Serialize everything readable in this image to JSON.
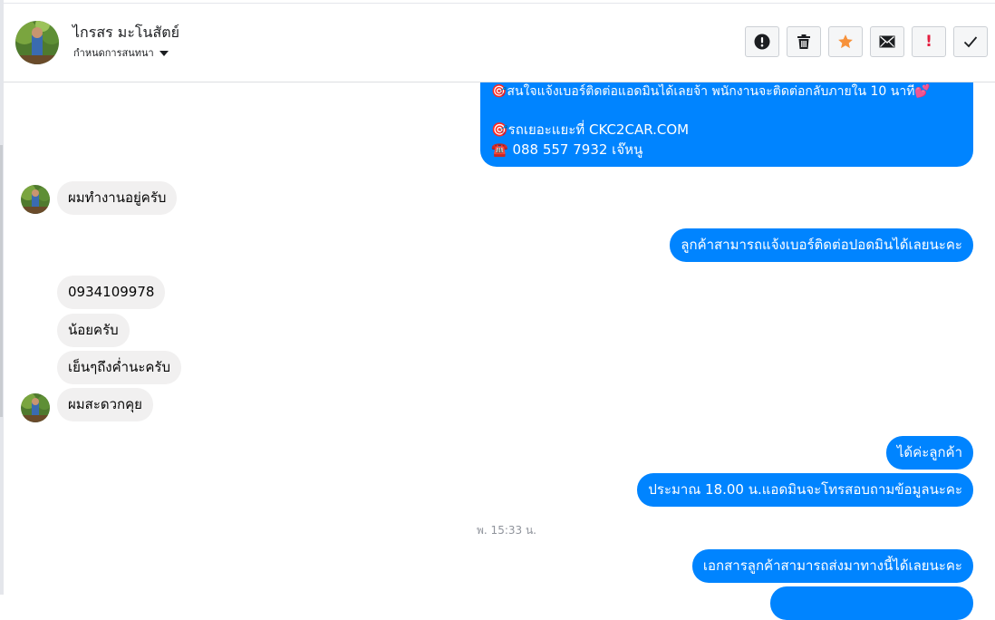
{
  "header": {
    "name": "ไกรสร มะโนสัตย์",
    "subtitle": "กำหนดการสนทนา",
    "actions": [
      {
        "icon": "alert-icon",
        "label": "report"
      },
      {
        "icon": "trash-icon",
        "label": "delete"
      },
      {
        "icon": "star-icon",
        "label": "star"
      },
      {
        "icon": "envelope-icon",
        "label": "mark unread"
      },
      {
        "icon": "exclamation-icon",
        "label": "important"
      },
      {
        "icon": "checkmark-icon",
        "label": "done"
      }
    ]
  },
  "messages": {
    "top_out": {
      "line1": "🎯สนใจแจ้งเบอร์ติดต่อแอดมินได้เลยจ้า พนักงานจะติดต่อกลับภายใน 10 นาที💕",
      "line2": "🎯รถเยอะแยะที่ CKC2CAR.COM",
      "line3": "☎️ 088 557 7932 เจ๊หนู"
    },
    "in1": "ผมทำงานอยู่ครับ",
    "out1": "ลูกค้าสามารถแจ้งเบอร์ติดต่อปอดมินได้เลยนะคะ",
    "in2": "0934109978",
    "in3": "น้อยครับ",
    "in4": "เย็นๆถึงค่ำนะครับ",
    "in5": "ผมสะดวกคุย",
    "out2": "ได้ค่ะลูกค้า",
    "out3": "ประมาณ 18.00 น.แอดมินจะโทรสอบถามข้อมูลนะคะ",
    "timestamp": "พ. 15:33 น.",
    "out4": "เอกสารลูกค้าสามารถส่งมาทางนี้ได้เลยนะคะ"
  },
  "colors": {
    "outgoing": "#0084ff",
    "incoming": "#f1f0f0",
    "star": "#f7923b",
    "important": "#e41e3f"
  }
}
